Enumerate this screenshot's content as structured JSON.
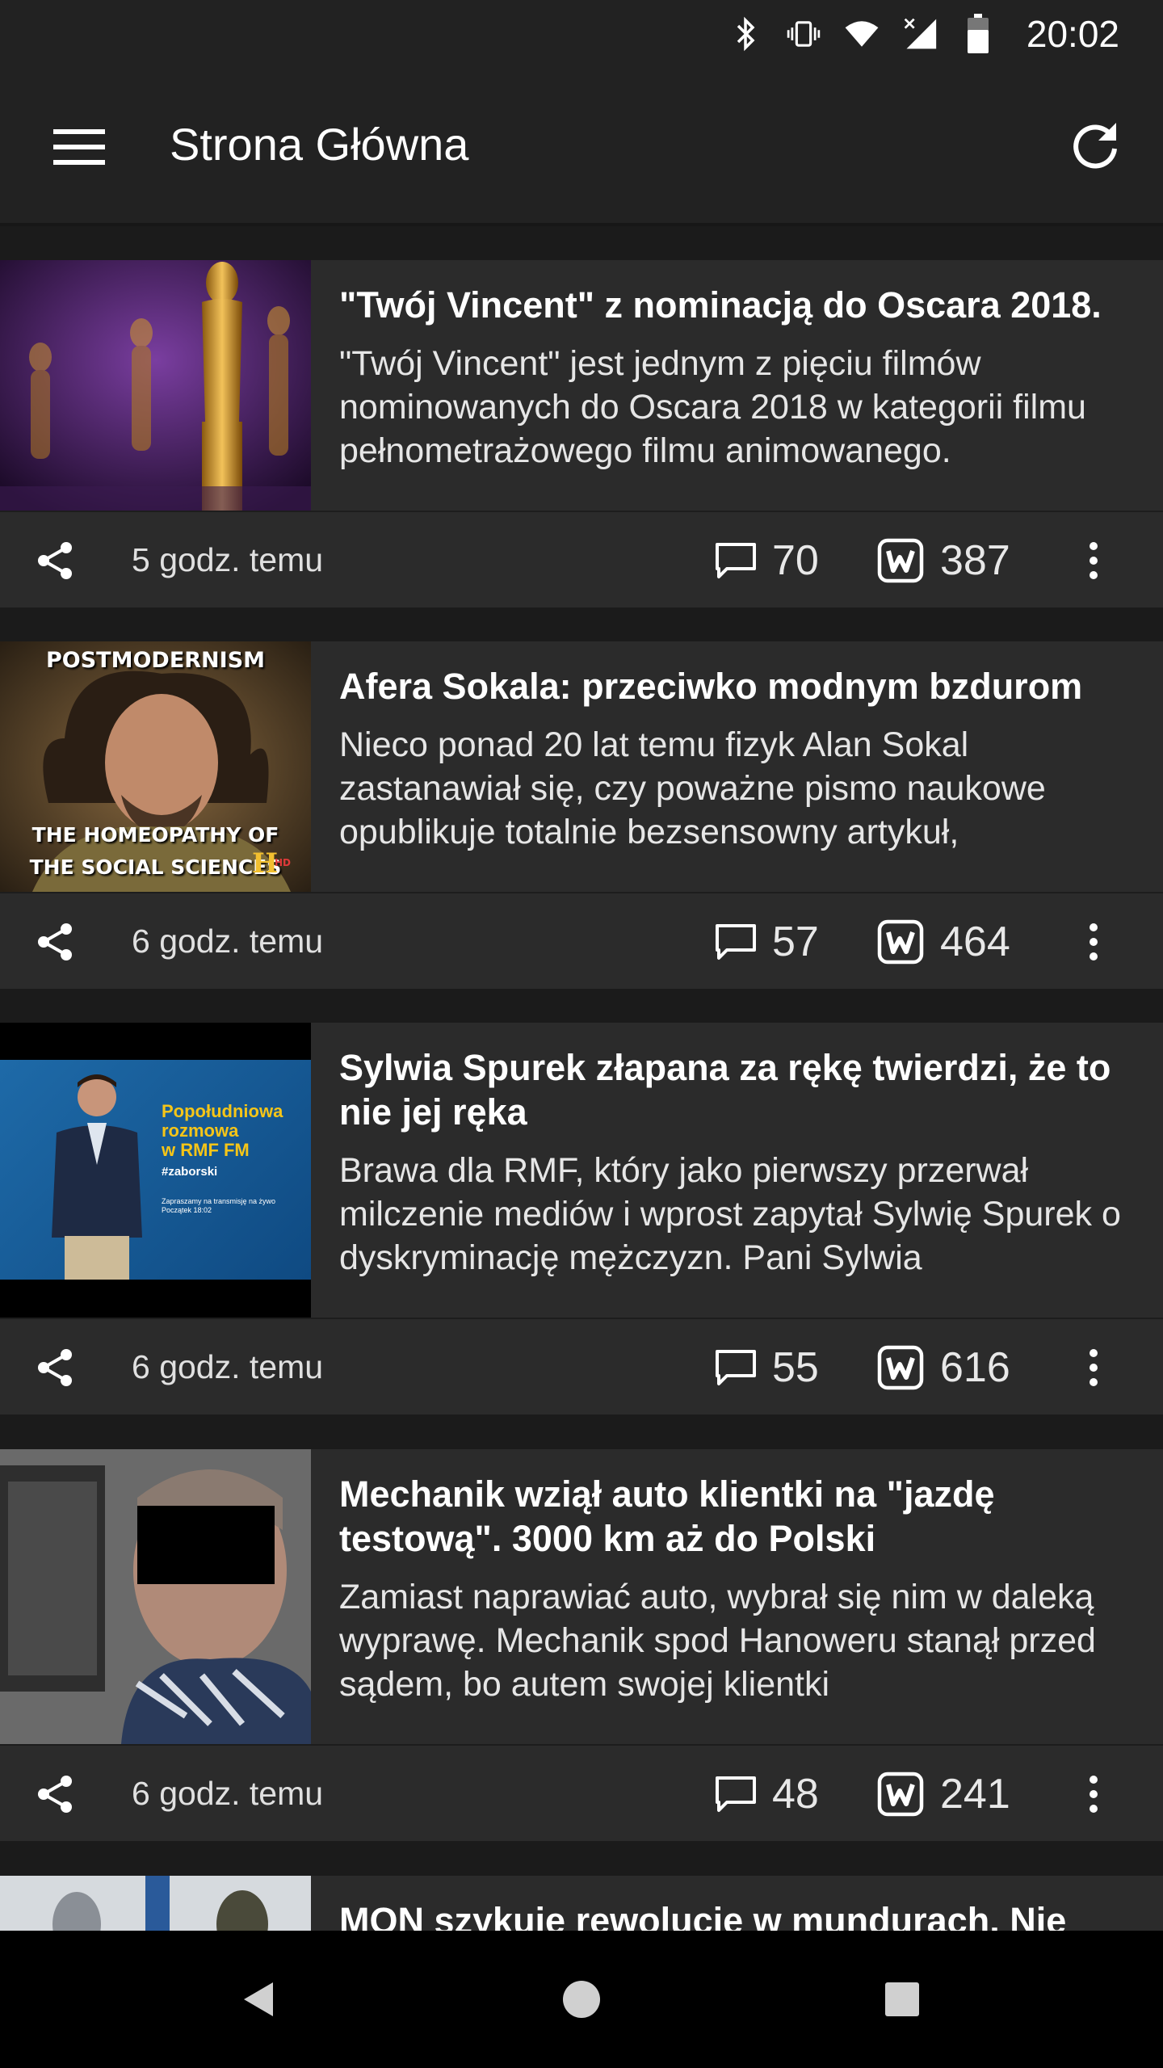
{
  "status_bar": {
    "time": "20:02",
    "icons": [
      "bluetooth-icon",
      "vibrate-icon",
      "wifi-icon",
      "cell-signal-icon",
      "battery-icon"
    ]
  },
  "app_bar": {
    "title": "Strona Główna",
    "menu_icon": "hamburger-menu-icon",
    "refresh_icon": "refresh-icon"
  },
  "colors": {
    "background": "#1b1b1b",
    "bar": "#222222",
    "card": "#2b2b2b",
    "text": "#ffffff"
  },
  "articles": [
    {
      "title": "\"Twój Vincent\" z nominacją do Oscara 2018.",
      "excerpt": "\"Twój Vincent\" jest jednym z pięciu filmów nominowanych do Oscara 2018 w kategorii filmu pełnometrażowego filmu animowanego.",
      "time_ago": "5 godz. temu",
      "comments": "70",
      "votes": "387"
    },
    {
      "title": "Afera Sokala: przeciwko modnym bzdurom",
      "excerpt": "Nieco ponad 20 lat temu fizyk Alan Sokal zastanawiał się, czy poważne pismo naukowe opublikuje totalnie bezsensowny artykuł,",
      "time_ago": "6 godz. temu",
      "comments": "57",
      "votes": "464",
      "image_text": {
        "top": "POSTMODERNISM",
        "bottom_line1": "THE HOMEOPATHY OF",
        "bottom_line2": "THE SOCIAL SCIENCES"
      }
    },
    {
      "title": "Sylwia Spurek złapana za rękę twierdzi, że to nie jej ręka",
      "excerpt": "Brawa dla RMF, który jako pierwszy przerwał milczenie mediów i wprost zapytał Sylwię Spurek o dyskryminację mężczyzn. Pani Sylwia",
      "time_ago": "6 godz. temu",
      "comments": "55",
      "votes": "616",
      "image_text": {
        "line1": "Popołudniowa",
        "line2": "rozmowa",
        "line3": "w RMF FM",
        "tag": "#zaborski",
        "small": "Zapraszamy na transmisję na żywo",
        "small2": "Początek 18:02"
      }
    },
    {
      "title": "Mechanik wziął auto klientki na \"jazdę testową\". 3000 km aż do Polski",
      "excerpt": "Zamiast naprawiać auto, wybrał się nim w daleką wyprawę. Mechanik spod Hanoweru stanął przed sądem, bo autem swojej klientki",
      "time_ago": "6 godz. temu",
      "comments": "48",
      "votes": "241"
    },
    {
      "title": "MON szykuje rewolucję w mundurach. Nie"
    }
  ],
  "nav_bar": {
    "icons": [
      "back-icon",
      "home-icon",
      "recents-icon"
    ]
  }
}
